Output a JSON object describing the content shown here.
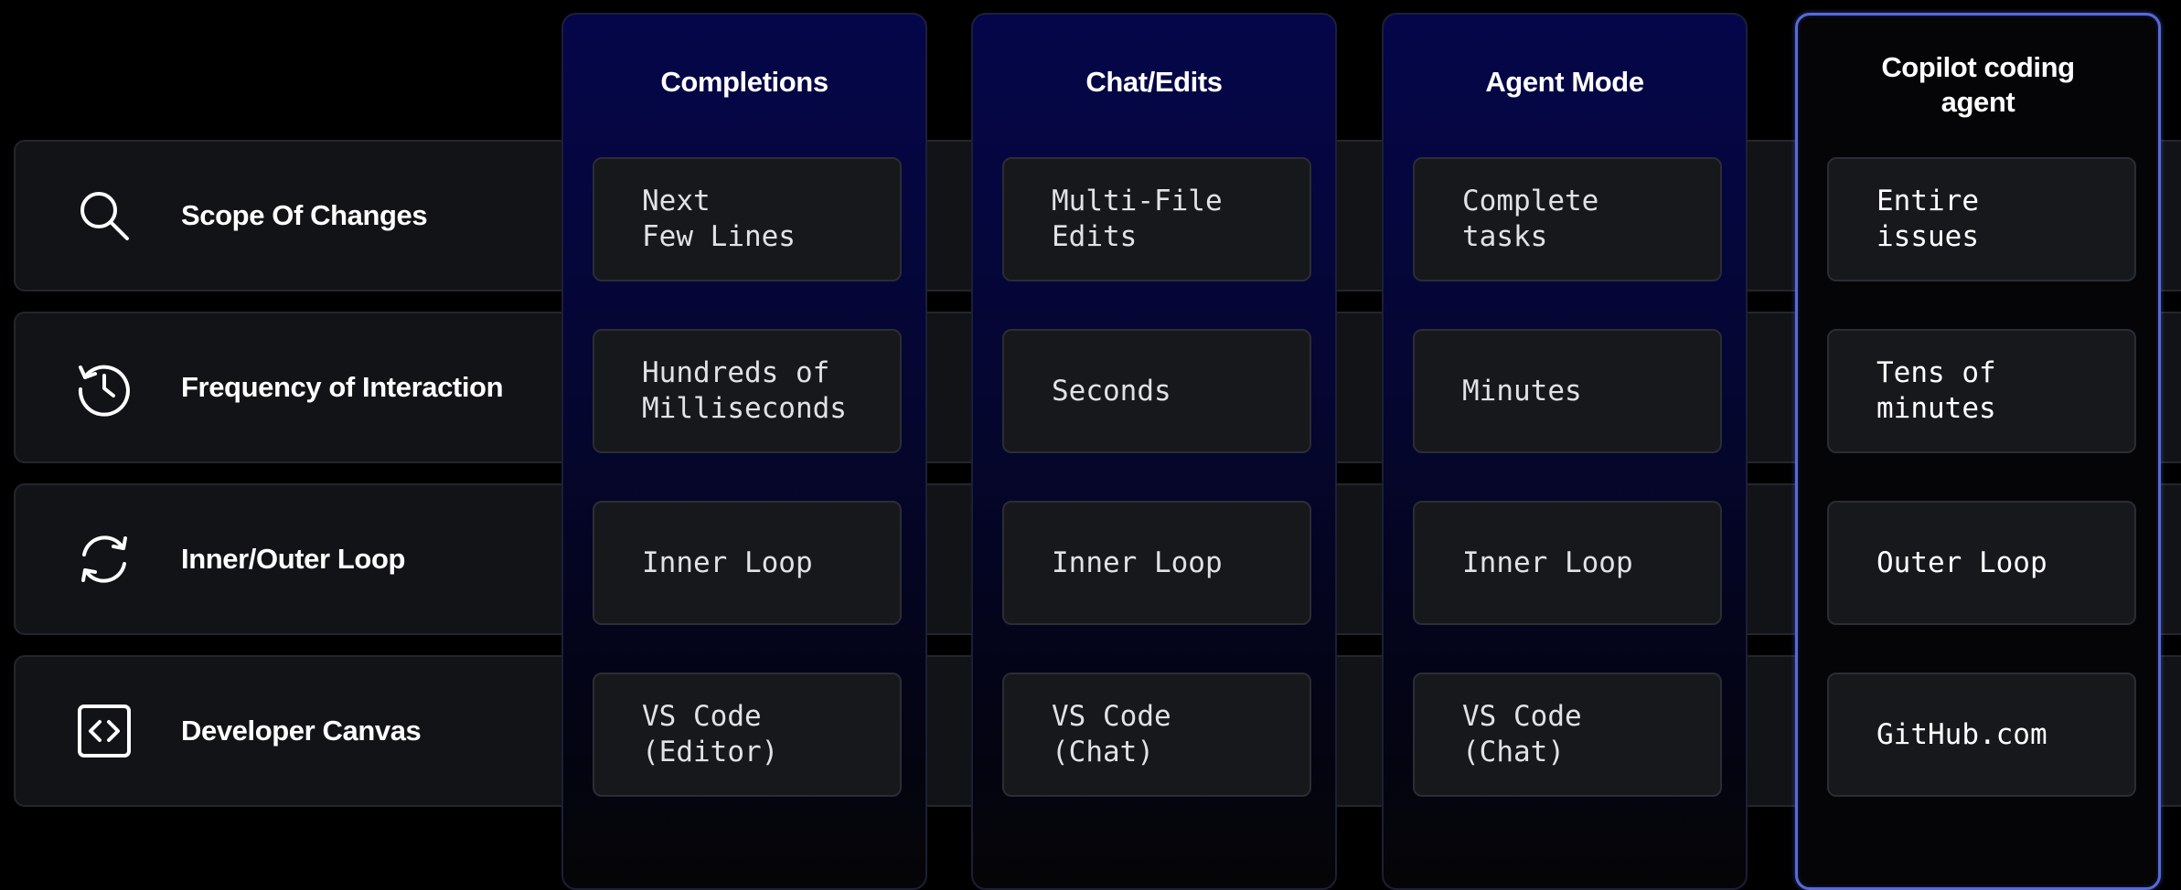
{
  "rows": [
    {
      "label": "Scope Of Changes",
      "icon": "search-icon"
    },
    {
      "label": "Frequency of Interaction",
      "icon": "history-clock-icon"
    },
    {
      "label": "Inner/Outer Loop",
      "icon": "refresh-cycle-icon"
    },
    {
      "label": "Developer Canvas",
      "icon": "code-brackets-icon"
    }
  ],
  "columns": [
    {
      "title": "Completions",
      "cells": [
        "Next\nFew Lines",
        "Hundreds of\nMilliseconds",
        "Inner Loop",
        "VS Code\n(Editor)"
      ]
    },
    {
      "title": "Chat/Edits",
      "cells": [
        "Multi-File\nEdits",
        "Seconds",
        "Inner Loop",
        "VS Code\n(Chat)"
      ]
    },
    {
      "title": "Agent Mode",
      "cells": [
        "Complete\ntasks",
        "Minutes",
        "Inner Loop",
        "VS Code\n(Chat)"
      ]
    },
    {
      "title": "Copilot coding agent",
      "cells": [
        "Entire\nissues",
        "Tens of\nminutes",
        "Outer Loop",
        "GitHub.com"
      ]
    }
  ],
  "colors": {
    "background": "#000000",
    "row_background": "#111316",
    "column_gradient_top": "#05064a",
    "highlight_border": "#5a69d8"
  }
}
